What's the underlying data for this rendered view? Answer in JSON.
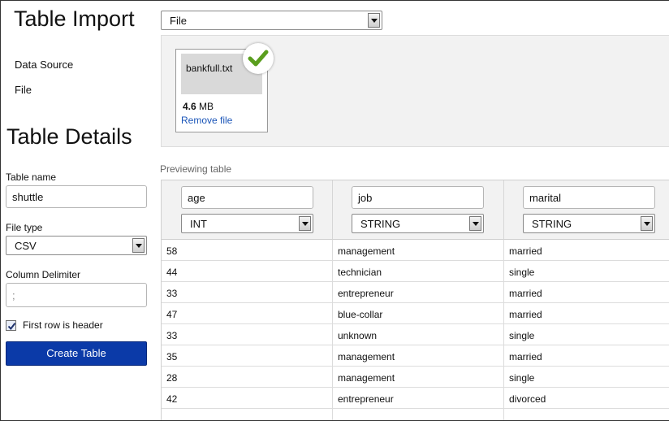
{
  "import": {
    "title": "Table Import",
    "data_source_label": "Data Source",
    "data_source_value": "File",
    "file_label": "File"
  },
  "file_card": {
    "name": "bankfull.txt",
    "size_value": "4.6",
    "size_unit": "MB",
    "remove_label": "Remove file"
  },
  "details": {
    "title": "Table Details",
    "table_name_label": "Table name",
    "table_name_value": "shuttle",
    "file_type_label": "File type",
    "file_type_value": "CSV",
    "delimiter_label": "Column Delimiter",
    "delimiter_placeholder": ";",
    "first_row_header_label": "First row is header",
    "first_row_header_checked": true,
    "create_button_label": "Create Table"
  },
  "preview": {
    "label": "Previewing table",
    "columns": [
      {
        "name": "age",
        "type": "INT"
      },
      {
        "name": "job",
        "type": "STRING"
      },
      {
        "name": "marital",
        "type": "STRING"
      }
    ],
    "rows": [
      [
        "58",
        "management",
        "married"
      ],
      [
        "44",
        "technician",
        "single"
      ],
      [
        "33",
        "entrepreneur",
        "married"
      ],
      [
        "47",
        "blue-collar",
        "married"
      ],
      [
        "33",
        "unknown",
        "single"
      ],
      [
        "35",
        "management",
        "married"
      ],
      [
        "28",
        "management",
        "single"
      ],
      [
        "42",
        "entrepreneur",
        "divorced"
      ]
    ]
  },
  "colors": {
    "accent_button": "#0b3aa8",
    "link": "#1a55b8",
    "success_check": "#5a9e1e"
  }
}
